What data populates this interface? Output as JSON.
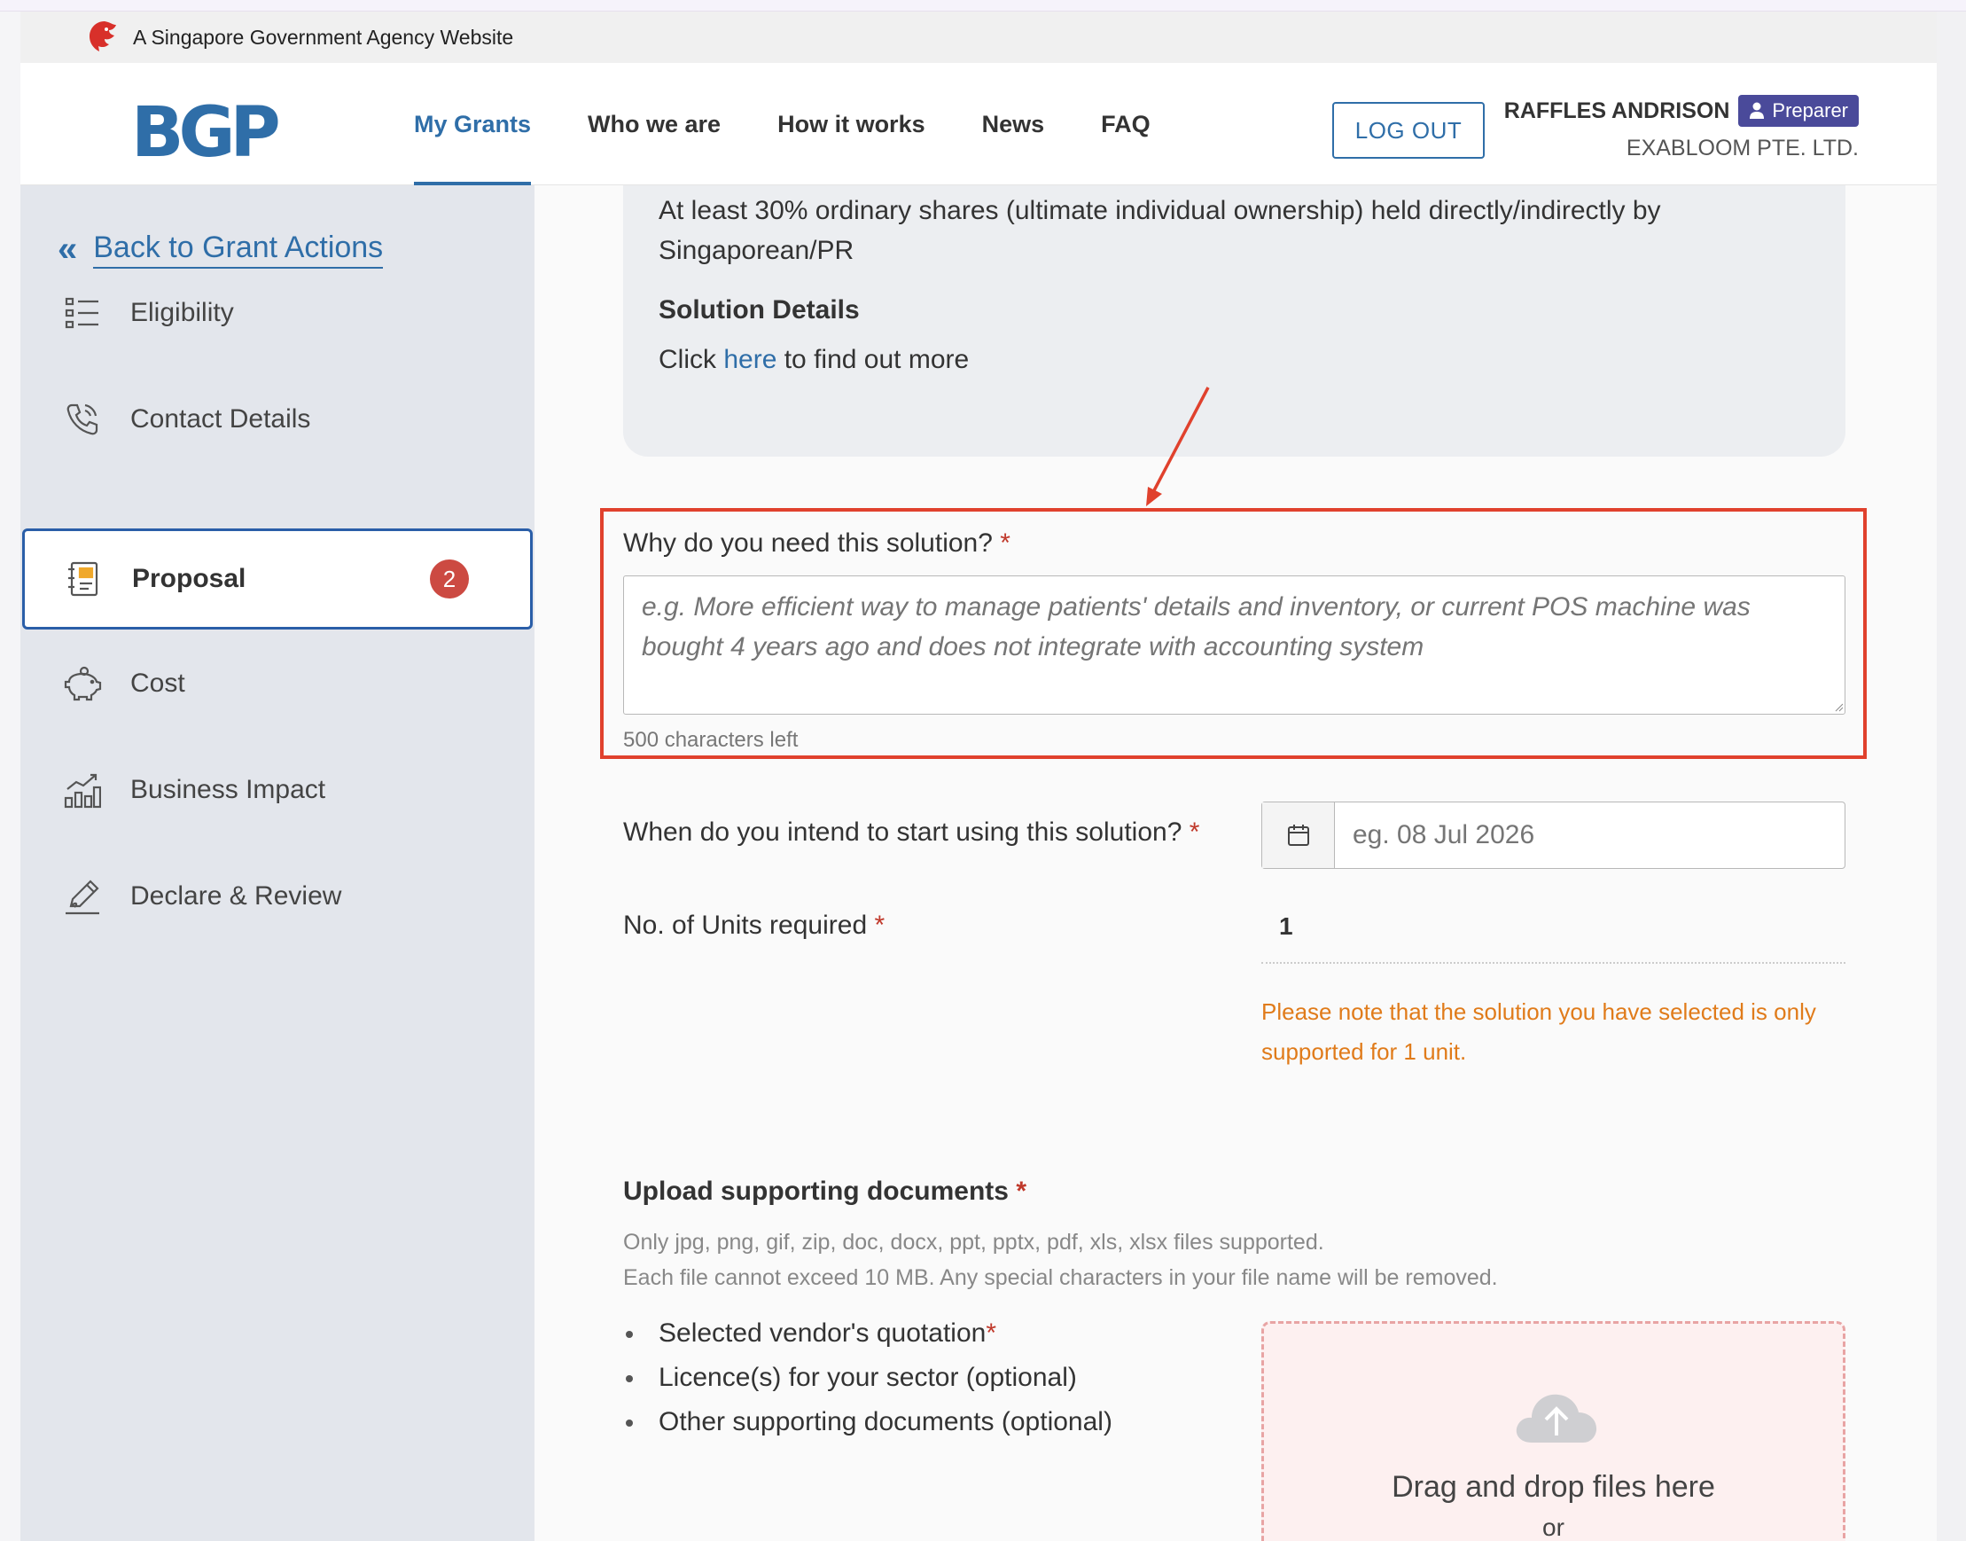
{
  "gov_banner": {
    "text": "A Singapore Government Agency Website"
  },
  "header": {
    "logo": "BGP",
    "nav": [
      "My Grants",
      "Who we are",
      "How it works",
      "News",
      "FAQ"
    ],
    "logout_label": "LOG OUT",
    "user_name": "RAFFLES ANDRISON",
    "role": "Preparer",
    "company": "EXABLOOM PTE. LTD."
  },
  "sidebar": {
    "back_label": "Back to Grant Actions",
    "items": [
      {
        "label": "Eligibility",
        "icon": "list-icon"
      },
      {
        "label": "Contact Details",
        "icon": "phone-icon"
      },
      {
        "label": "Proposal",
        "icon": "notebook-icon",
        "badge": "2",
        "active": true
      },
      {
        "label": "Cost",
        "icon": "piggy-bank-icon"
      },
      {
        "label": "Business Impact",
        "icon": "chart-icon"
      },
      {
        "label": "Declare & Review",
        "icon": "pen-icon"
      }
    ]
  },
  "info_card": {
    "ownership_text": "At least 30% ordinary shares (ultimate individual ownership) held directly/indirectly by Singaporean/PR",
    "solution_title": "Solution Details",
    "click_prefix": "Click ",
    "link_text": "here",
    "click_suffix": " to find out more"
  },
  "form": {
    "why_label": "Why do you need this solution?",
    "why_placeholder": "e.g. More efficient way to manage patients' details and inventory, or current POS machine was bought 4 years ago and does not integrate with accounting system",
    "chars_left": "500 characters left",
    "start_label": "When do you intend to start using this solution?",
    "start_placeholder": "eg. 08 Jul 2026",
    "units_label": "No. of Units required",
    "units_value": "1",
    "units_note": "Please note that the solution you have selected is only supported for 1 unit.",
    "required_mark": "*"
  },
  "upload": {
    "title": "Upload supporting documents",
    "hint_line1": "Only jpg, png, gif, zip, doc, docx, ppt, pptx, pdf, xls, xlsx files supported.",
    "hint_line2": "Each file cannot exceed 10 MB. Any special characters in your file name will be removed.",
    "docs": [
      "Selected vendor's quotation",
      "Licence(s) for your sector (optional)",
      "Other supporting documents (optional)"
    ],
    "dropzone_text": "Drag and drop files here",
    "dropzone_or": "or"
  },
  "colors": {
    "primary": "#2f6ea8",
    "sidebar_bg": "#e3e6ec",
    "annotation": "#e0412d",
    "warning": "#e07b1a",
    "badge": "#cc4a42",
    "role_badge": "#4a4a9a"
  }
}
